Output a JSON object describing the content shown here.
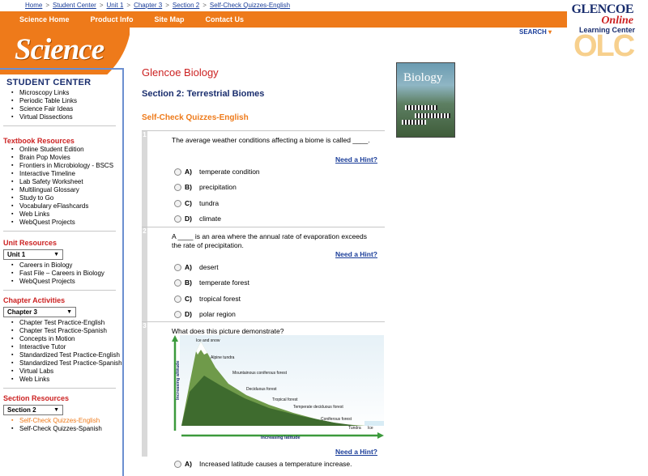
{
  "breadcrumb": [
    "Home",
    "Student Center",
    "Unit 1",
    "Chapter 3",
    "Section 2",
    "Self-Check Quizzes-English"
  ],
  "nav": [
    "Science Home",
    "Product Info",
    "Site Map",
    "Contact Us"
  ],
  "logo": "Science",
  "brand": {
    "line1": "GLENCOE",
    "line2": "Online",
    "line3": "Learning Center",
    "olc": "OLC"
  },
  "search_label": "SEARCH",
  "sidebar": {
    "title": "STUDENT CENTER",
    "student_links": [
      "Microscopy Links",
      "Periodic Table Links",
      "Science Fair Ideas",
      "Virtual Dissections"
    ],
    "textbook": {
      "heading": "Textbook Resources",
      "items": [
        "Online Student Edition",
        "Brain Pop Movies",
        "Frontiers in Microbiology - BSCS",
        "Interactive Timeline",
        "Lab Safety Worksheet",
        "Multilingual Glossary",
        "Study to Go",
        "Vocabulary eFlashcards",
        "Web Links",
        "WebQuest Projects"
      ]
    },
    "unit": {
      "heading": "Unit Resources",
      "select": "Unit 1",
      "items": [
        "Careers in Biology",
        "Fast File – Careers in Biology",
        "WebQuest Projects"
      ]
    },
    "chapter": {
      "heading": "Chapter Activities",
      "select": "Chapter 3",
      "items": [
        "Chapter Test Practice-English",
        "Chapter Test Practice-Spanish",
        "Concepts in Motion",
        "Interactive Tutor",
        "Standardized Test Practice-English",
        "Standardized Test Practice-Spanish",
        "Virtual Labs",
        "Web Links"
      ]
    },
    "section": {
      "heading": "Section Resources",
      "select": "Section 2",
      "items": [
        "Self-Check Quizzes-English",
        "Self-Check Quizzes-Spanish"
      ]
    }
  },
  "main": {
    "book_title": "Glencoe Biology",
    "section_title": "Section 2: Terrestrial Biomes",
    "quiz_title": "Self-Check Quizzes-English",
    "cover_title": "Biology",
    "hint_label": "Need a Hint?",
    "questions": [
      {
        "num": "1",
        "text": "The average weather conditions affecting a biome is called ____.",
        "options": [
          {
            "letter": "A)",
            "text": "temperate condition"
          },
          {
            "letter": "B)",
            "text": "precipitation"
          },
          {
            "letter": "C)",
            "text": "tundra"
          },
          {
            "letter": "D)",
            "text": "climate"
          }
        ]
      },
      {
        "num": "2",
        "text": "A ____ is an area where the annual rate of evaporation exceeds the rate of precipitation.",
        "options": [
          {
            "letter": "A)",
            "text": "desert"
          },
          {
            "letter": "B)",
            "text": "temperate forest"
          },
          {
            "letter": "C)",
            "text": "tropical forest"
          },
          {
            "letter": "D)",
            "text": "polar region"
          }
        ]
      },
      {
        "num": "3",
        "text": "What does this picture demonstrate?",
        "options": [
          {
            "letter": "A)",
            "text": "Increased latitude causes a temperature increase."
          }
        ]
      }
    ],
    "diagram": {
      "labels": [
        "Ice and snow",
        "Alpine tundra",
        "Mountainous coniferous forest",
        "Deciduous forest",
        "Tropical forest",
        "Temperate deciduous forest",
        "Coniferous forest",
        "Tundra",
        "Ice"
      ],
      "y_axis": "Increasing altitude",
      "x_axis": "Increasing latitude"
    }
  },
  "colors": {
    "orange": "#ee7a1a",
    "navy": "#1a2e6e",
    "red": "#cc2222",
    "link": "#1a3d99"
  }
}
